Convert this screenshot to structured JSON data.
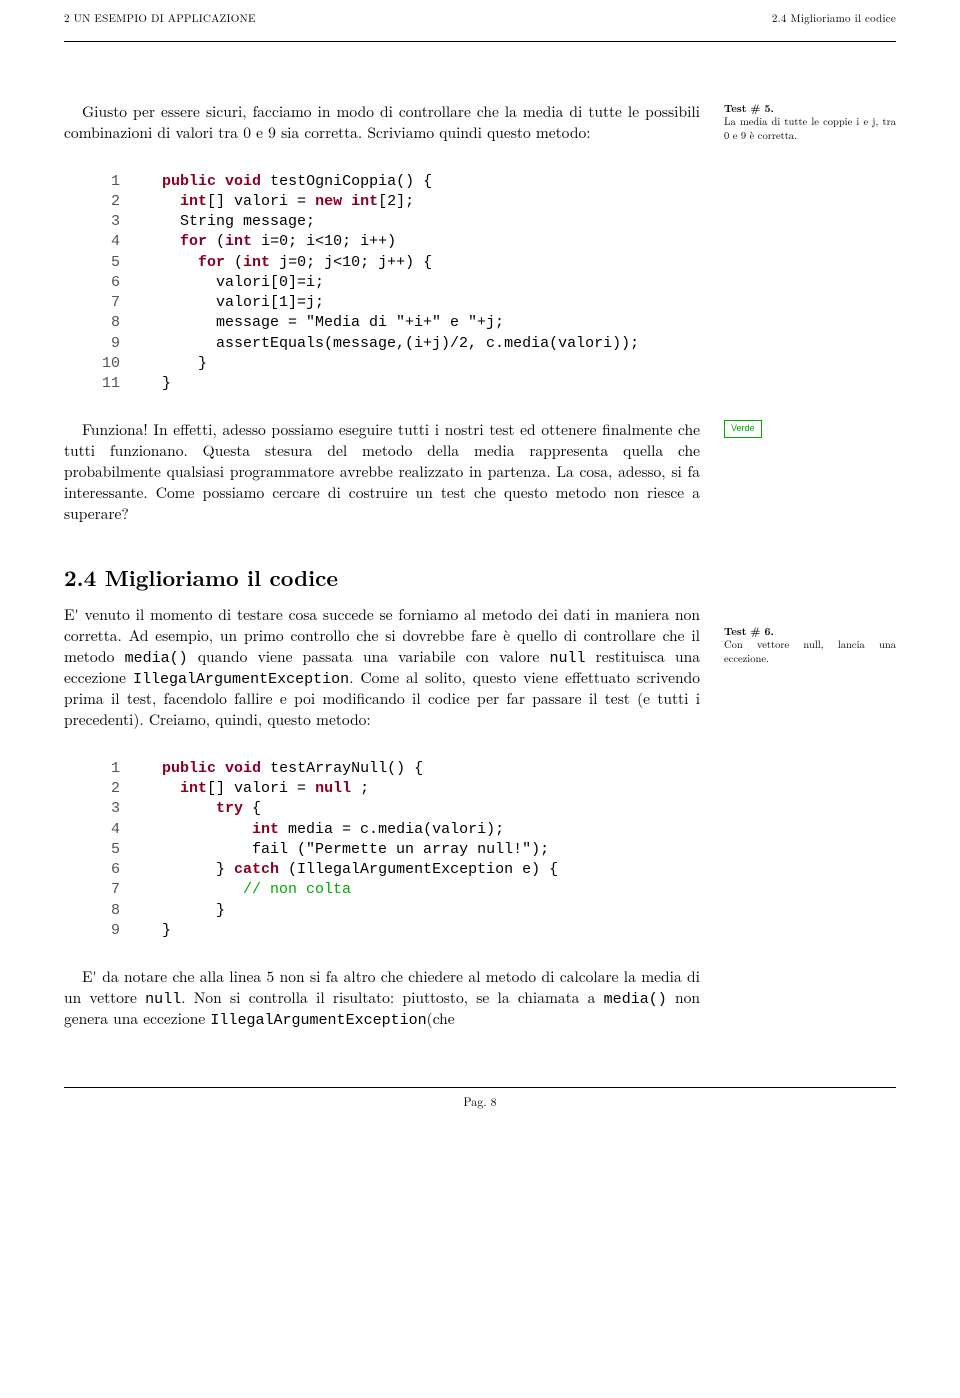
{
  "header": {
    "left": "2  UN ESEMPIO DI APPLICAZIONE",
    "right": "2.4  Miglioriamo il codice"
  },
  "para1": "Giusto per essere sicuri, facciamo in modo di controllare che la media di tutte le possibili combinazioni di valori tra 0 e 9 sia corretta. Scriviamo quindi questo metodo:",
  "note1a": "Test # 5.",
  "note1b": "La media di tutte le coppie i e j, tra 0 e 9 è corretta.",
  "code1": {
    "l1a": "public",
    "l1b": " ",
    "l1c": "void",
    "l1d": " testOgniCoppia() {",
    "l2a": "int",
    "l2b": "[] valori = ",
    "l2c": "new",
    "l2d": " ",
    "l2e": "int",
    "l2f": "[2];",
    "l3": "String message;",
    "l4a": "for",
    "l4b": " (",
    "l4c": "int",
    "l4d": " i=0; i<10; i++)",
    "l5a": "for",
    "l5b": " (",
    "l5c": "int",
    "l5d": " j=0; j<10; j++) {",
    "l6": "valori[0]=i;",
    "l7": "valori[1]=j;",
    "l8": "message = \"Media di \"+i+\" e \"+j;",
    "l9": "assertEquals(message,(i+j)/2, c.media(valori));",
    "l10": "}",
    "l11": "}"
  },
  "para2": "Funziona! In effetti, adesso possiamo eseguire tutti i nostri test ed ottenere finalmente che tutti funzionano. Questa stesura del metodo della media rappresenta quella che probabilmente qualsiasi programmatore avrebbe realizzato in partenza. La cosa, adesso, si fa interessante. Come possiamo cercare di costruire un test che questo metodo non riesce a superare?",
  "verde": "Verde",
  "h2": "2.4   Miglioriamo il codice",
  "para3a": "E' venuto il momento di testare cosa succede se forniamo al metodo dei dati in maniera non corretta.  Ad esempio, un primo controllo che si dovrebbe fare è quello di controllare che il metodo ",
  "code_media": "media()",
  "para3b": " quando viene passata una variabile con valore ",
  "code_null": "null",
  "para3c": " restituisca una eccezione ",
  "code_iae": "IllegalArgumentException",
  "para3d": ". Come al solito, questo viene effettuato scrivendo prima il test, facendolo fallire e poi modificando il codice per far passare il test (e tutti i precedenti).  Creiamo, quindi, questo metodo:",
  "note2a": "Test # 6.",
  "note2b": "Con vettore null, lancia una eccezione.",
  "code2": {
    "l1a": "public",
    "l1b": " ",
    "l1c": "void",
    "l1d": " testArrayNull() {",
    "l2a": "int",
    "l2b": "[] valori = ",
    "l2c": "null",
    "l2d": " ;",
    "l3a": "try",
    "l3b": " {",
    "l4a": "int",
    "l4b": " media = c.media(valori);",
    "l5": "fail (\"Permette un array null!\");",
    "l6a": "} ",
    "l6b": "catch",
    "l6c": " (IllegalArgumentException e) {",
    "l7": "// non colta",
    "l8": "}",
    "l9": "}"
  },
  "para4a": "E' da notare che alla linea 5 non si fa altro che chiedere al metodo di calcolare la media di un vettore ",
  "para4b": ".  Non si controlla il risultato:  piuttosto, se la chiamata a ",
  "para4c": " non genera una eccezione ",
  "para4d": "(che",
  "footer": "Pag. 8"
}
